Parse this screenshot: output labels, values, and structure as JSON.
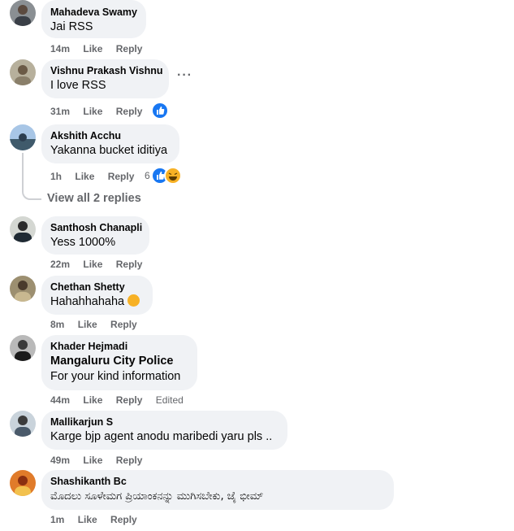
{
  "comments": [
    {
      "author": "Mahadeva Swamy",
      "text": "Jai RSS",
      "time": "14m",
      "like": "Like",
      "reply": "Reply"
    },
    {
      "author": "Vishnu Prakash Vishnu",
      "text": "I love RSS",
      "time": "31m",
      "like": "Like",
      "reply": "Reply",
      "more": "···"
    },
    {
      "author": "Akshith Acchu",
      "text": "Yakanna bucket iditiya",
      "time": "1h",
      "like": "Like",
      "reply": "Reply",
      "reaction_count": "6"
    },
    {
      "author": "Santhosh Chanapli",
      "text": "Yess 1000%",
      "time": "22m",
      "like": "Like",
      "reply": "Reply"
    },
    {
      "author": "Chethan Shetty",
      "text": "Hahahhahaha",
      "time": "8m",
      "like": "Like",
      "reply": "Reply"
    },
    {
      "author": "Khader Hejmadi",
      "tag": "Mangaluru City Police",
      "text": "For your kind information",
      "time": "44m",
      "like": "Like",
      "reply": "Reply",
      "edited": "Edited"
    },
    {
      "author": "Mallikarjun S",
      "text": "Karge bjp agent anodu maribedi yaru pls ..",
      "time": "49m",
      "like": "Like",
      "reply": "Reply"
    },
    {
      "author": "Shashikanth Bc",
      "text": "ಮೊದಲು ಸೂಳೇಮಗ ಪ್ರಿಯಾಂಕನನ್ನು ಮುಗಿಸಬೇಕು, ಜೈ ಭೀಮ್",
      "time": "1m",
      "like": "Like",
      "reply": "Reply"
    }
  ],
  "view_replies": "View all 2 replies",
  "colors": {
    "bubble": "#f0f2f5",
    "meta": "#65676b",
    "like_blue": "#1877f2",
    "haha_yellow": "#f7b125"
  }
}
